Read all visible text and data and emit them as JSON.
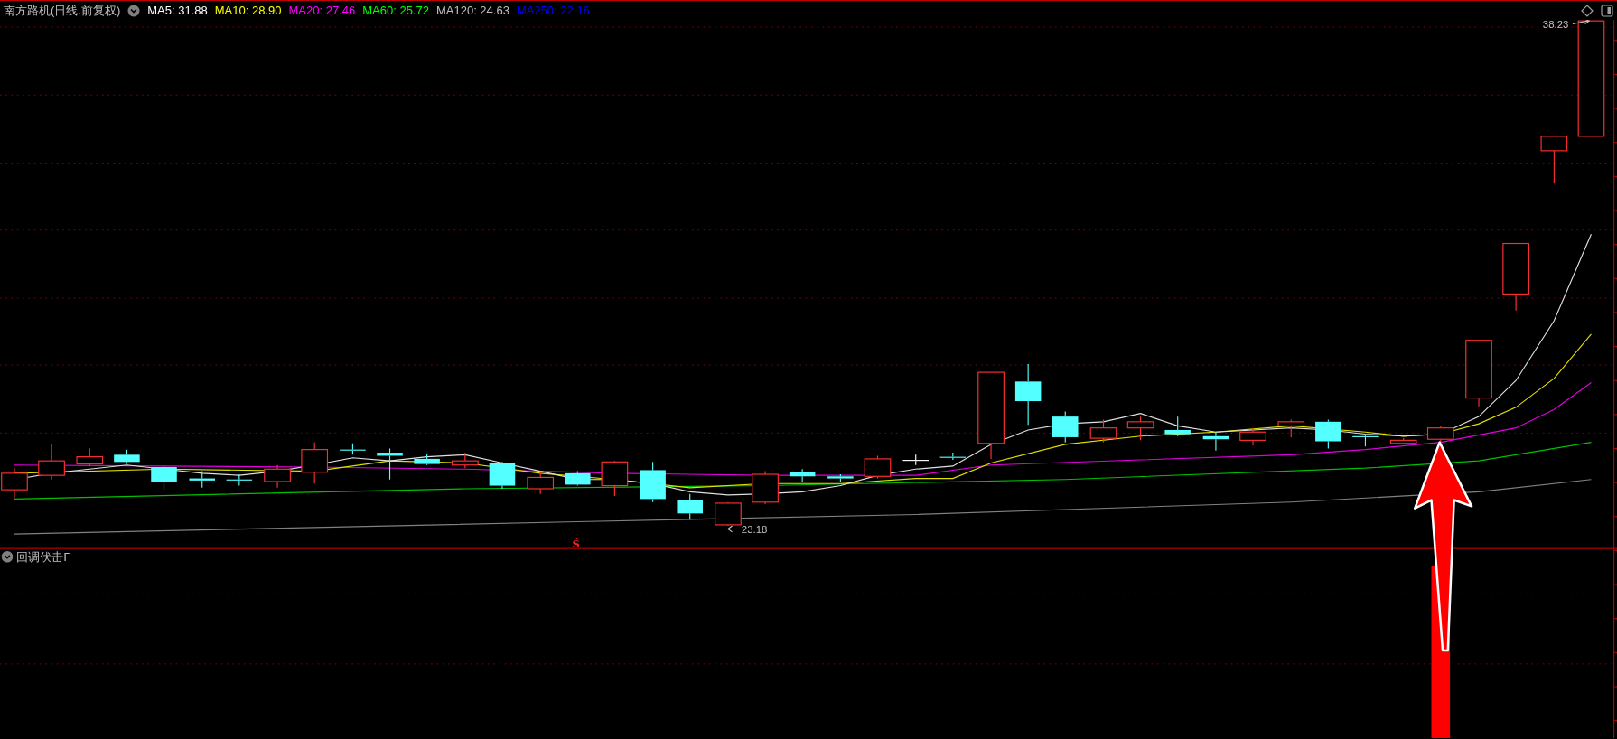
{
  "title": "南方路机(日线.前复权)",
  "indicators": [
    {
      "label": "MA5: 31.88",
      "color": "#ffffff"
    },
    {
      "label": "MA10: 28.90",
      "color": "#ffff00"
    },
    {
      "label": "MA20: 27.46",
      "color": "#ff00ff"
    },
    {
      "label": "MA60: 25.72",
      "color": "#00ff00"
    },
    {
      "label": "MA120: 24.63",
      "color": "#c0c0c0"
    },
    {
      "label": "MA250: 22.16",
      "color": "#0000ff"
    }
  ],
  "price_chart": {
    "high_label": "38.23",
    "low_label": "23.18",
    "signal_mark": "Ŝ"
  },
  "lower_panel": {
    "title": "回调伏击F"
  }
}
